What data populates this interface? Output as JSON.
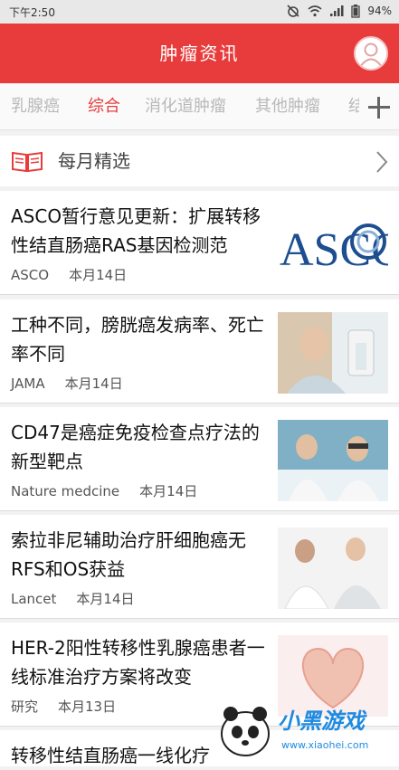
{
  "statusbar": {
    "time": "下午2:50",
    "battery": "94%"
  },
  "header": {
    "title": "肿瘤资讯"
  },
  "tabs": [
    {
      "label": "乳腺癌"
    },
    {
      "label": "综合"
    },
    {
      "label": "消化道肿瘤"
    },
    {
      "label": "其他肿瘤"
    },
    {
      "label": "结"
    }
  ],
  "active_tab": "综合",
  "monthly": {
    "label": "每月精选"
  },
  "articles": [
    {
      "title": "ASCO暂行意见更新：扩展转移性结直肠癌RAS基因检测范",
      "source": "ASCO",
      "date": "本月14日",
      "thumb_text": "ASCO"
    },
    {
      "title": "工种不同，膀胱癌发病率、死亡率不同",
      "source": "JAMA",
      "date": "本月14日"
    },
    {
      "title": "CD47是癌症免疫检查点疗法的新型靶点",
      "source": "Nature medcine",
      "date": "本月14日"
    },
    {
      "title": "索拉非尼辅助治疗肝细胞癌无RFS和OS获益",
      "source": "Lancet",
      "date": "本月14日"
    },
    {
      "title": "HER-2阳性转移性乳腺癌患者一线标准治疗方案将改变",
      "source": "研究",
      "date": "本月13日"
    },
    {
      "title": "转移性结直肠癌一线化疗"
    }
  ],
  "watermark": {
    "text": "小黑游戏",
    "url": "www.xiaohei.com"
  },
  "colors": {
    "brand": "#e83c3c",
    "tab_inactive": "#b9b9b9"
  }
}
